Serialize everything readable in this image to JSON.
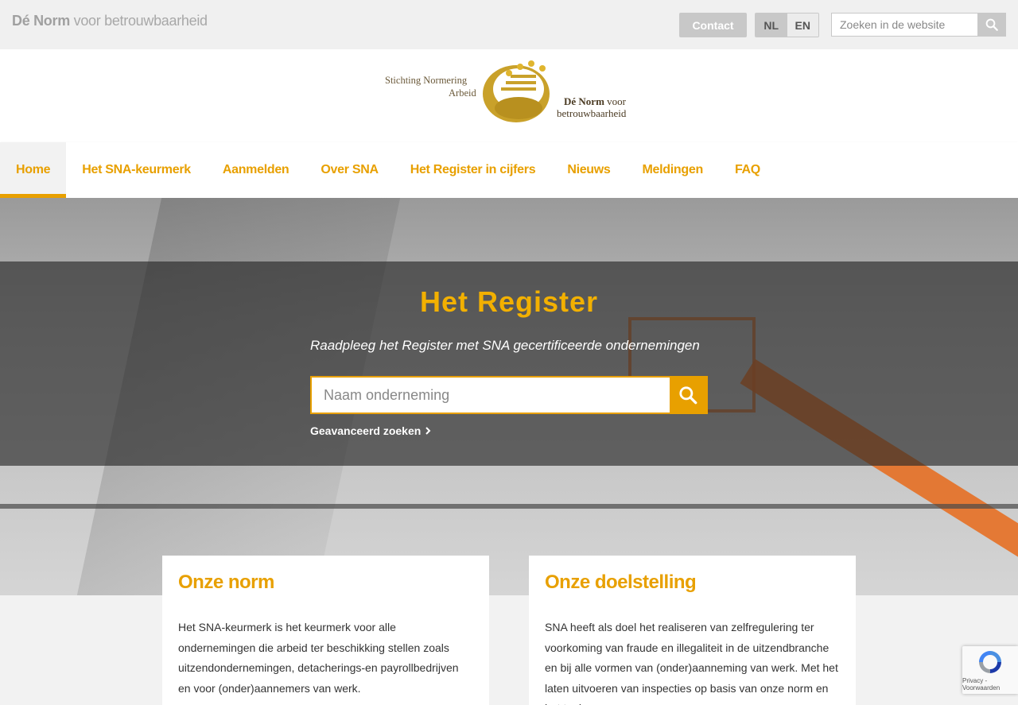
{
  "topbar": {
    "tagline_bold": "Dé Norm",
    "tagline_rest": " voor betrouwbaarheid",
    "contact_label": "Contact",
    "languages": [
      {
        "label": "NL",
        "active": true
      },
      {
        "label": "EN",
        "active": false
      }
    ],
    "search_placeholder": "Zoeken in de website",
    "search_icon": "search-icon"
  },
  "logo": {
    "line1": "Stichting Normering",
    "line2": "Arbeid",
    "line3_bold": "Dé Norm",
    "line3_rest": " voor",
    "line4": "betrouwbaarheid"
  },
  "nav": {
    "items": [
      {
        "label": "Home",
        "active": true
      },
      {
        "label": "Het SNA-keurmerk",
        "active": false
      },
      {
        "label": "Aanmelden",
        "active": false
      },
      {
        "label": "Over SNA",
        "active": false
      },
      {
        "label": "Het Register in cijfers",
        "active": false
      },
      {
        "label": "Nieuws",
        "active": false
      },
      {
        "label": "Meldingen",
        "active": false
      },
      {
        "label": "FAQ",
        "active": false
      }
    ]
  },
  "hero": {
    "title": "Het Register",
    "subtitle": "Raadpleeg het Register met SNA gecertificeerde ondernemingen",
    "search_placeholder": "Naam onderneming",
    "advanced_link": "Geavanceerd zoeken"
  },
  "cards": [
    {
      "title": "Onze norm",
      "text": "Het SNA-keurmerk is het keurmerk voor alle ondernemingen die arbeid ter beschikking stellen zoals uitzendondernemingen, detacherings-en payrollbedrijven en voor (onder)aannemers van werk."
    },
    {
      "title": "Onze doelstelling",
      "text": "SNA heeft als doel het realiseren van zelfregulering ter voorkoming van fraude en illegaliteit in de uitzendbranche en bij alle vormen van (onder)aanneming van werk. Met het laten uitvoeren van inspecties op basis van onze norm en het toekennen van"
    }
  ],
  "recaptcha": {
    "label": "Privacy - Voorwaarden"
  },
  "colors": {
    "accent": "#e8a000",
    "hero_title": "#f2b000",
    "crane": "#e86a1a"
  }
}
